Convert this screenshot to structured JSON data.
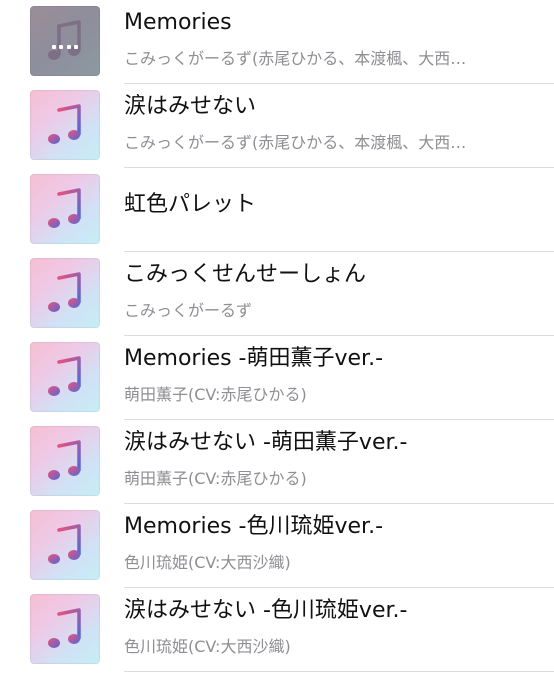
{
  "songs": [
    {
      "title": "Memories",
      "artist": "こみっくがーるず(赤尾ひかる、本渡楓、大西…",
      "playing": true
    },
    {
      "title": "涙はみせない",
      "artist": "こみっくがーるず(赤尾ひかる、本渡楓、大西…",
      "playing": false
    },
    {
      "title": "虹色パレット",
      "artist": "",
      "playing": false
    },
    {
      "title": "こみっくせんせーしょん",
      "artist": "こみっくがーるず",
      "playing": false
    },
    {
      "title": "Memories -萌田薫子ver.-",
      "artist": "萌田薫子(CV:赤尾ひかる)",
      "playing": false
    },
    {
      "title": "涙はみせない -萌田薫子ver.-",
      "artist": "萌田薫子(CV:赤尾ひかる)",
      "playing": false
    },
    {
      "title": "Memories -色川琉姫ver.-",
      "artist": "色川琉姫(CV:大西沙織)",
      "playing": false
    },
    {
      "title": "涙はみせない -色川琉姫ver.-",
      "artist": "色川琉姫(CV:大西沙織)",
      "playing": false
    }
  ],
  "icons": {
    "artwork": "music-note-icon",
    "now_playing": "now-playing-indicator-icon"
  },
  "colors": {
    "title": "#111111",
    "subtitle": "#8e8e93",
    "divider": "#dcdcdc"
  }
}
